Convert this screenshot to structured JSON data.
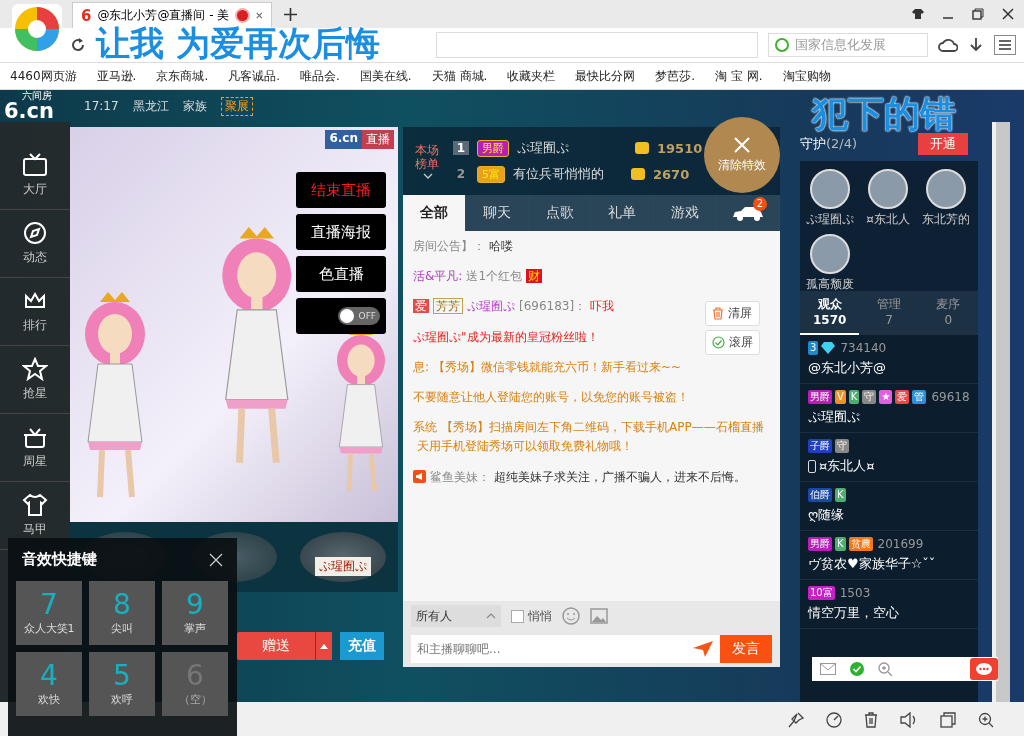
{
  "browser": {
    "site_icon": "6",
    "tab_title": "@东北小芳@直播间 - 美",
    "search_placeholder": "国家信息化发展",
    "bookmarks": [
      "4460网页游",
      "亚马逊.",
      "京东商城.",
      "凡客诚品.",
      "唯品会.",
      "国美在线.",
      "天猫 商城.",
      "收藏夹栏",
      "最快比分网",
      "梦芭莎.",
      "淘 宝 网.",
      "淘宝购物"
    ]
  },
  "lyrics": [
    "让我 为爱再次后悔",
    "犯下的错"
  ],
  "header": {
    "logo": "6.cn",
    "logo_sub": "六间房",
    "time": "17:17",
    "region": "黑龙江",
    "family_label": "家族",
    "family_badge": "聚展"
  },
  "nav": [
    {
      "label": "大厅",
      "kind": "tv"
    },
    {
      "label": "动态",
      "kind": "compass"
    },
    {
      "label": "排行",
      "kind": "crown"
    },
    {
      "label": "抢星",
      "kind": "star"
    },
    {
      "label": "周星",
      "kind": "gift"
    },
    {
      "label": "马甲",
      "kind": "shirt"
    }
  ],
  "video": {
    "brand": "6.cn",
    "live": "直播",
    "controls": [
      {
        "label": "结束直播",
        "kind": "danger"
      },
      {
        "label": "直播海报",
        "kind": "normal"
      },
      {
        "label": "色直播",
        "kind": "normal"
      }
    ],
    "toggle": {
      "label": "OFF",
      "on": false
    }
  },
  "podium": [
    "ぷ瑆囿ぷ"
  ],
  "gift": {
    "send": "赠送",
    "recharge": "充值"
  },
  "sound_panel": {
    "title": "音效快捷键",
    "keys": [
      {
        "key": "7",
        "label": "众人大笑1",
        "disabled": false
      },
      {
        "key": "8",
        "label": "尖叫",
        "disabled": false
      },
      {
        "key": "9",
        "label": "掌声",
        "disabled": false
      },
      {
        "key": "4",
        "label": "欢快",
        "disabled": false
      },
      {
        "key": "5",
        "label": "欢呼",
        "disabled": false
      },
      {
        "key": "6",
        "label": "（空）",
        "disabled": true
      }
    ]
  },
  "ranking": {
    "title": "本场榜单",
    "rows": [
      {
        "rank": "1",
        "badge": "男爵",
        "color": "#b81fb8",
        "name": "ぷ瑆囿ぷ",
        "score": "19510"
      },
      {
        "rank": "2",
        "badge": "5富",
        "color": "#e8a020",
        "name": "有位兵哥悄悄的",
        "score": "2670"
      }
    ],
    "clear_effects": "清除特效"
  },
  "chat": {
    "tabs": [
      {
        "label": "全部",
        "selected": true
      },
      {
        "label": "聊天",
        "selected": false
      },
      {
        "label": "点歌",
        "selected": false
      },
      {
        "label": "礼单",
        "selected": false
      },
      {
        "label": "游戏",
        "selected": false
      }
    ],
    "car_count": "2",
    "messages": [
      {
        "parts": [
          {
            "text": "房间公告】：",
            "kind": "grey"
          },
          {
            "text": "哈喽",
            "kind": "plain"
          }
        ]
      },
      {
        "parts": [
          {
            "text": "活&平凡:",
            "kind": "name"
          },
          {
            "text": "送1个红包",
            "kind": "grey"
          },
          {
            "text": "财",
            "kind": "envelope"
          }
        ]
      },
      {
        "parts": [
          {
            "text": "爱",
            "kind": "tag"
          },
          {
            "text": "芳芳",
            "kind": "outline"
          },
          {
            "text": "ぷ瑆囿ぷ",
            "kind": "name"
          },
          {
            "text": "[696183]：",
            "kind": "grey"
          },
          {
            "text": "吓我",
            "kind": "red"
          }
        ]
      },
      {
        "parts": [
          {
            "text": "ぷ瑆囿ぷ\"成为最新的皇冠粉丝啦！",
            "kind": "red"
          }
        ]
      },
      {
        "parts": [
          {
            "text": "息:",
            "kind": "orange"
          },
          {
            "text": "【秀场】微信零钱就能充六币！新手看过来~~",
            "kind": "orange"
          }
        ]
      },
      {
        "parts": [
          {
            "text": "不要随意让他人登陆您的账号，以免您的账号被盗！",
            "kind": "orange"
          }
        ]
      },
      {
        "parts": [
          {
            "text": "系统",
            "kind": "orange"
          },
          {
            "text": "【秀场】扫描房间左下角二维码，下载手机APP——石榴直播",
            "kind": "orange"
          },
          {
            "text": "天用手机登陆秀场可以领取免费礼物哦！",
            "kind": "orange"
          }
        ]
      },
      {
        "parts": [
          {
            "text": "鲨鱼美妹：",
            "kind": "grey"
          },
          {
            "text": "超纯美妹子求关注，广播不骗人，进来不后悔。",
            "kind": "plain"
          }
        ]
      }
    ],
    "clear": "清屏",
    "scroll": "滚屏",
    "recipient": "所有人",
    "whisper": {
      "label": "悄悄",
      "checked": false
    },
    "placeholder": "和主播聊聊吧...",
    "send": "发言"
  },
  "guard": {
    "title": "守护",
    "count": "(2/4)",
    "open": "开通",
    "members": [
      "ぷ瑆囿ぷ",
      "¤东北人",
      "东北芳的",
      "孤高颓废"
    ]
  },
  "audience": {
    "tabs": [
      {
        "label": "观众",
        "count": "1570",
        "selected": true
      },
      {
        "label": "管理",
        "count": "7",
        "selected": false
      },
      {
        "label": "麦序",
        "count": "0",
        "selected": false
      }
    ],
    "rows": [
      {
        "badges": [
          {
            "text": "3",
            "color": "#1e88c8"
          }
        ],
        "diamond": true,
        "mobile": false,
        "number": "734140",
        "name": "@东北小芳@"
      },
      {
        "badges": [
          {
            "text": "男爵",
            "color": "#b81fb8"
          },
          {
            "text": "V",
            "color": "#f0902a"
          },
          {
            "text": "K",
            "color": "#4caf70"
          },
          {
            "text": "守",
            "color": "#888888"
          },
          {
            "text": "★",
            "color": "#e060e0"
          },
          {
            "text": "爱",
            "color": "#e84848"
          },
          {
            "text": "管",
            "color": "#2a90d8"
          }
        ],
        "diamond": false,
        "mobile": false,
        "number": "69618",
        "name": "ぷ瑆囿ぷ"
      },
      {
        "badges": [
          {
            "text": "子爵",
            "color": "#2040c0"
          },
          {
            "text": "守",
            "color": "#888888"
          }
        ],
        "diamond": false,
        "mobile": true,
        "number": "",
        "name": "¤东北人¤"
      },
      {
        "badges": [
          {
            "text": "伯爵",
            "color": "#1848a8"
          },
          {
            "text": "K",
            "color": "#4caf70"
          }
        ],
        "diamond": false,
        "mobile": false,
        "number": "",
        "name": "ღ随缘"
      },
      {
        "badges": [
          {
            "text": "男爵",
            "color": "#b81fb8"
          },
          {
            "text": "K",
            "color": "#4caf70"
          },
          {
            "text": "贫農",
            "color": "#f07818"
          }
        ],
        "diamond": false,
        "mobile": false,
        "number": "201699",
        "name": "ヴ贫农♥家族华子☆ˇˇ"
      },
      {
        "badges": [
          {
            "text": "10富",
            "color": "#c820c8"
          }
        ],
        "diamond": false,
        "mobile": false,
        "number": "1503",
        "name": "情空万里，空心"
      }
    ]
  }
}
